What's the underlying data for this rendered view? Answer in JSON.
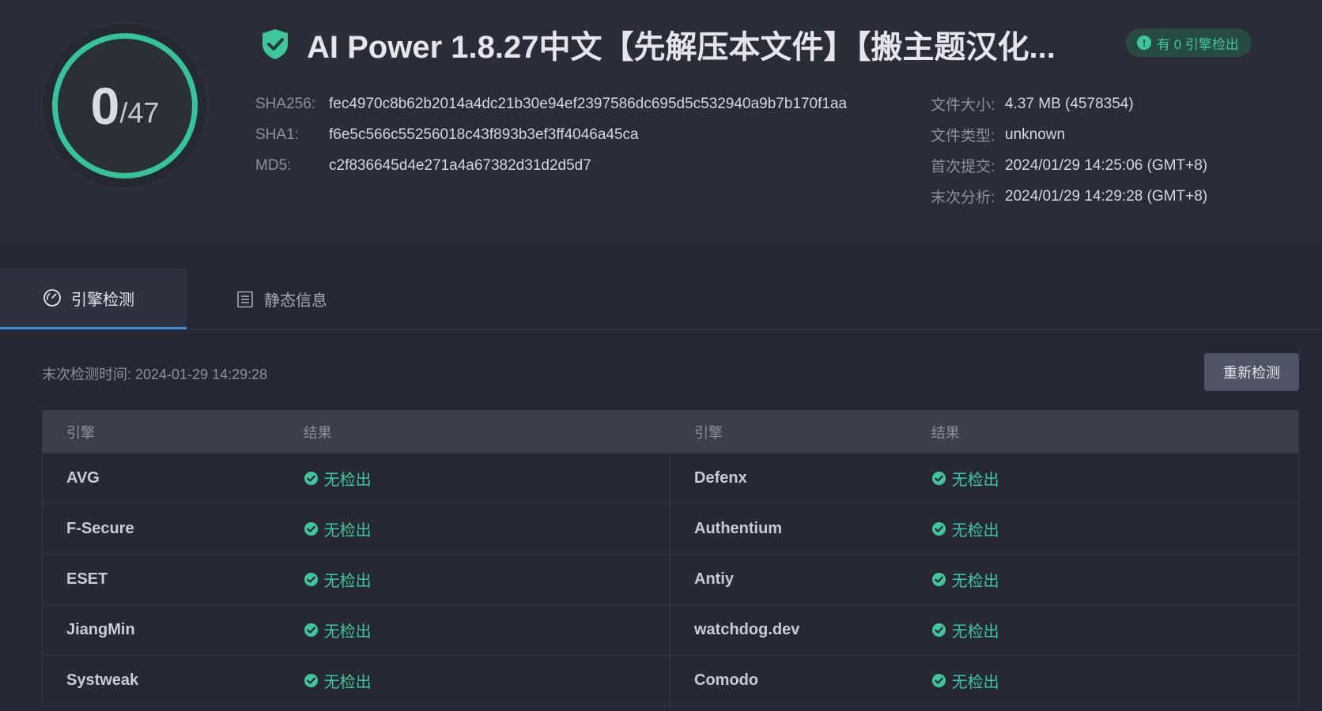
{
  "score": {
    "detected": "0",
    "total": "/47"
  },
  "file": {
    "title": "AI Power 1.8.27中文【先解压本文件】【搬主题汉化...",
    "badge": "有 0 引擎检出"
  },
  "hashes": [
    {
      "label": "SHA256:",
      "value": "fec4970c8b62b2014a4dc21b30e94ef2397586dc695d5c532940a9b7b170f1aa"
    },
    {
      "label": "SHA1:",
      "value": "f6e5c566c55256018c43f893b3ef3ff4046a45ca"
    },
    {
      "label": "MD5:",
      "value": "c2f836645d4e271a4a67382d31d2d5d7"
    }
  ],
  "meta": [
    {
      "label": "文件大小:",
      "value": "4.37 MB (4578354)"
    },
    {
      "label": "文件类型:",
      "value": "unknown"
    },
    {
      "label": "首次提交:",
      "value": "2024/01/29 14:25:06 (GMT+8)"
    },
    {
      "label": "末次分析:",
      "value": "2024/01/29 14:29:28 (GMT+8)"
    }
  ],
  "tabs": [
    {
      "label": "引擎检测",
      "icon": "gauge-icon",
      "active": true
    },
    {
      "label": "静态信息",
      "icon": "list-icon",
      "active": false
    }
  ],
  "last_check": "末次检测时间: 2024-01-29 14:29:28",
  "rescan_label": "重新检测",
  "table": {
    "headers": [
      "引擎",
      "结果",
      "引擎",
      "结果"
    ],
    "rows": [
      {
        "left_engine": "AVG",
        "left_result": "无检出",
        "right_engine": "Defenx",
        "right_result": "无检出"
      },
      {
        "left_engine": "F-Secure",
        "left_result": "无检出",
        "right_engine": "Authentium",
        "right_result": "无检出"
      },
      {
        "left_engine": "ESET",
        "left_result": "无检出",
        "right_engine": "Antiy",
        "right_result": "无检出"
      },
      {
        "left_engine": "JiangMin",
        "left_result": "无检出",
        "right_engine": "watchdog.dev",
        "right_result": "无检出"
      },
      {
        "left_engine": "Systweak",
        "left_result": "无检出",
        "right_engine": "Comodo",
        "right_result": "无检出"
      }
    ]
  },
  "colors": {
    "accent_green": "#3ec79d",
    "tab_underline": "#3f8fe0",
    "background": "#262933"
  }
}
